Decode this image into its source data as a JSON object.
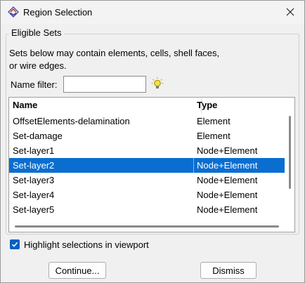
{
  "window": {
    "title": "Region Selection",
    "icon": "abaqus-app-icon",
    "close_icon": "close-icon"
  },
  "group": {
    "legend": "Eligible Sets",
    "description_line1": "Sets below may contain elements, cells, shell faces,",
    "description_line2": "or wire edges."
  },
  "filter": {
    "label": "Name filter:",
    "value": "",
    "placeholder": "",
    "help_icon": "lightbulb-icon"
  },
  "table": {
    "columns": [
      "Name",
      "Type"
    ],
    "rows": [
      {
        "name": "OffsetElements-delamination",
        "type": "Element",
        "selected": false
      },
      {
        "name": "Set-damage",
        "type": "Element",
        "selected": false
      },
      {
        "name": "Set-layer1",
        "type": "Node+Element",
        "selected": false
      },
      {
        "name": "Set-layer2",
        "type": "Node+Element",
        "selected": true
      },
      {
        "name": "Set-layer3",
        "type": "Node+Element",
        "selected": false
      },
      {
        "name": "Set-layer4",
        "type": "Node+Element",
        "selected": false
      },
      {
        "name": "Set-layer5",
        "type": "Node+Element",
        "selected": false
      }
    ],
    "selection_color": "#0a6ed1"
  },
  "options": {
    "highlight_label": "Highlight selections in viewport",
    "highlight_checked": true
  },
  "buttons": {
    "continue_label": "Continue...",
    "dismiss_label": "Dismiss"
  }
}
